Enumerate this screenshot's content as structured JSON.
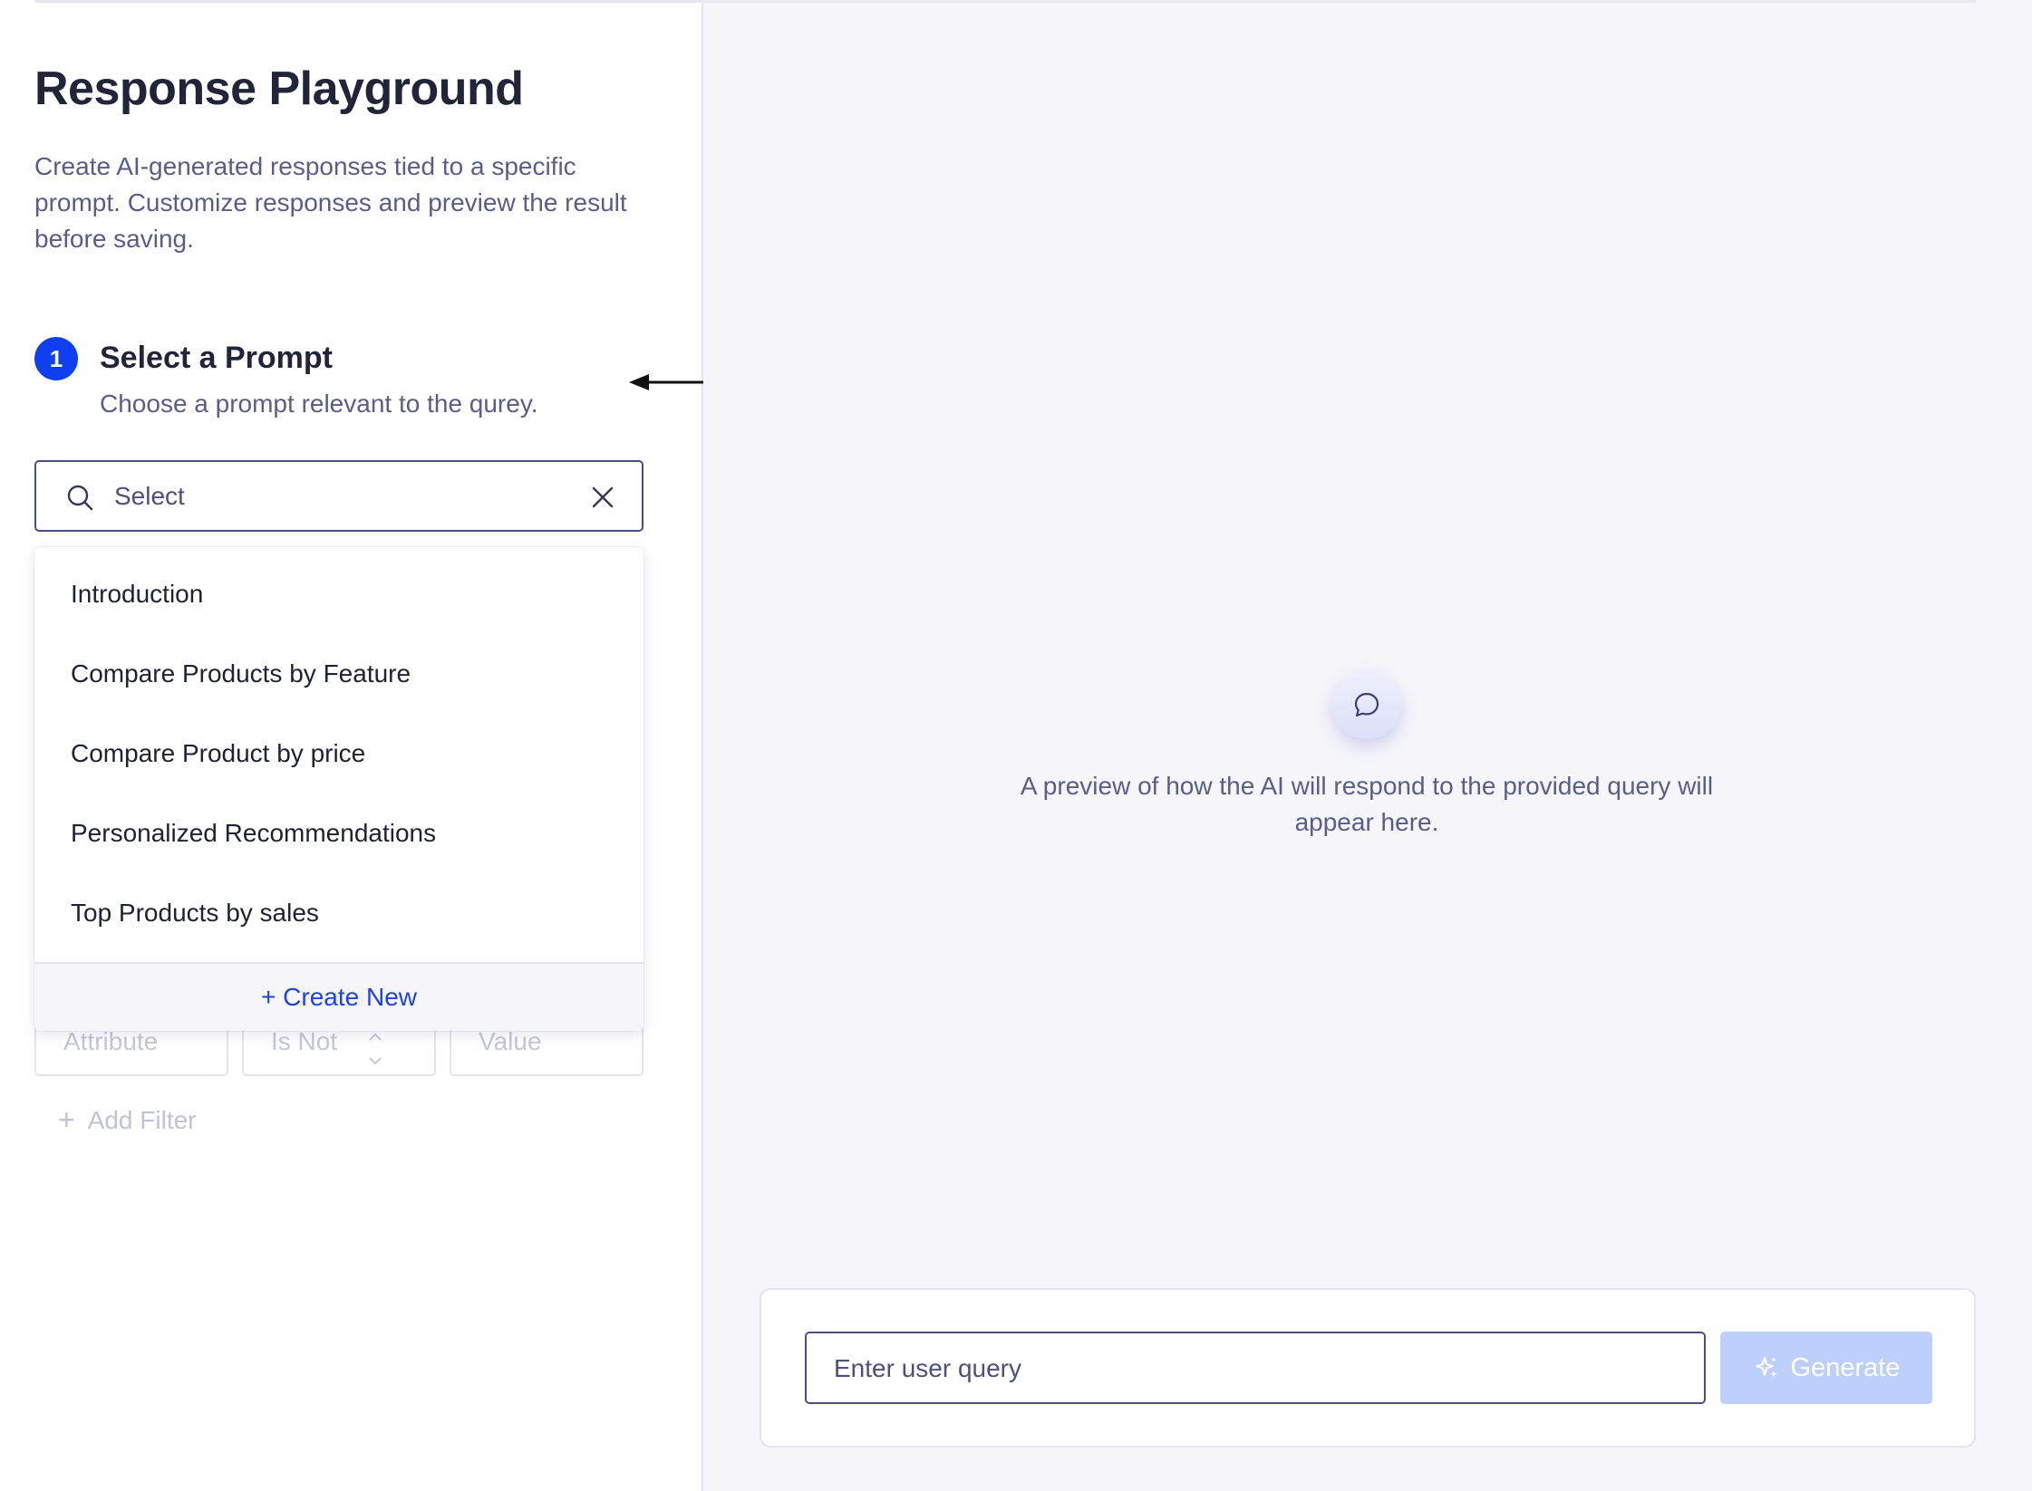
{
  "page": {
    "title": "Response Playground",
    "description": "Create AI-generated responses tied to a specific prompt. Customize responses and preview the result before saving."
  },
  "step1": {
    "number": "1",
    "title": "Select a Prompt",
    "subtitle": "Choose a prompt relevant to the qurey."
  },
  "prompt_select": {
    "placeholder": "Select",
    "value": "",
    "icons": {
      "leading": "search-icon",
      "trailing": "close-icon"
    }
  },
  "dropdown": {
    "options": [
      "Introduction",
      "Compare Products by Feature",
      "Compare Product by price",
      "Personalized Recommendations",
      "Top Products by sales"
    ],
    "create_new_label": "+ Create New"
  },
  "filters": {
    "attribute_placeholder": "Attribute",
    "operator_value": "Is Not",
    "value_placeholder": "Value",
    "add_filter_label": "Add Filter"
  },
  "preview": {
    "icon": "chat-bubble-icon",
    "empty_text": "A preview of how the AI will respond to the provided query will appear here."
  },
  "query": {
    "placeholder": "Enter user query",
    "value": "",
    "generate_label": "Generate",
    "generate_icon": "sparkle-icon"
  },
  "colors": {
    "accent": "#0f3ff0",
    "link": "#1d42e6",
    "muted_text": "#5a5d8a",
    "panel_bg": "#f5f5fa",
    "button_disabled": "#bcd0fb"
  }
}
